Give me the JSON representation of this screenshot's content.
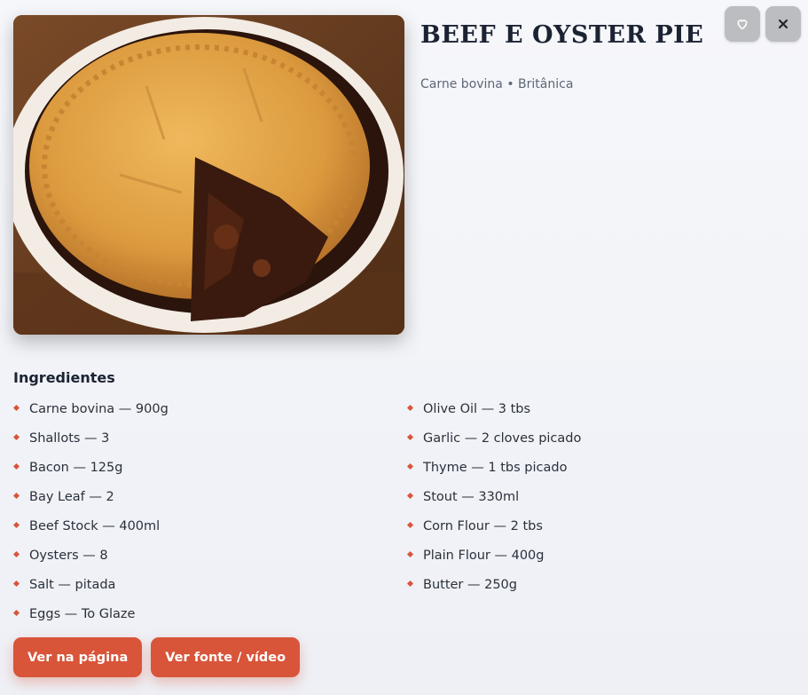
{
  "recipe": {
    "title": "BEEF E OYSTER PIE",
    "meta": "Carne bovina • Britânica"
  },
  "ingredients": {
    "heading": "Ingredientes",
    "left": [
      "Carne bovina — 900g",
      "Shallots — 3",
      "Bacon — 125g",
      "Bay Leaf — 2",
      "Beef Stock — 400ml",
      "Oysters — 8",
      "Salt — pitada",
      "Eggs — To Glaze"
    ],
    "right": [
      "Olive Oil — 3 tbs",
      "Garlic — 2 cloves picado",
      "Thyme — 1 tbs picado",
      "Stout — 330ml",
      "Corn Flour — 2 tbs",
      "Plain Flour — 400g",
      "Butter — 250g"
    ]
  },
  "actions": {
    "view_page": "Ver na página",
    "view_source": "Ver fonte / vídeo"
  },
  "icons": {
    "favorite": "heart-icon",
    "close": "close-icon"
  },
  "colors": {
    "accent": "#d8553a",
    "icon_button_bg": "#bcbdc0",
    "title": "#1b2333"
  }
}
